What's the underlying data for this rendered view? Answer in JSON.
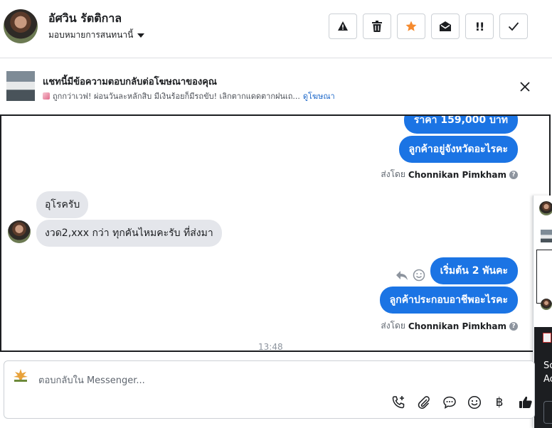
{
  "header": {
    "contact_name": "อัศวิน รัตติกาล",
    "assign_label": "มอบหมายการสนทนานี้"
  },
  "toolbar": {
    "icons": [
      "warning-icon",
      "trash-icon",
      "star-icon",
      "envelope-open-icon",
      "follow-up-icon",
      "check-icon"
    ],
    "follow_up_label": "!!",
    "star_color": "#f58a2e"
  },
  "ad_banner": {
    "title": "แชทนี้มีข้อความตอบกลับต่อโฆษณาของคุณ",
    "snippet": "ถูกกว่าเวฟ! ผ่อนวันละหลักสิบ มีเงินร้อยก็มีรถขับ! เลิกตากแดดตากฝนเถ...",
    "link": "ดูโฆษณา"
  },
  "messages": [
    {
      "dir": "out",
      "text": "ราคา 159,000 บาท"
    },
    {
      "dir": "out",
      "text": "ลูกค้าอยู่จังหวัดอะไรคะ"
    },
    {
      "type": "sent_by",
      "prefix": "ส่งโดย",
      "name": "Chonnikan Pimkham"
    },
    {
      "dir": "in",
      "text": "อุโรครับ"
    },
    {
      "dir": "in",
      "text": "งวด2,xxx กว่า ทุกคันไหมคะรับ ที่ส่งมา"
    },
    {
      "dir": "out",
      "text": "เริ่มต้น 2 พันคะ"
    },
    {
      "dir": "out",
      "text": "ลูกค้าประกอบอาชีพอะไรคะ"
    },
    {
      "type": "sent_by",
      "prefix": "ส่งโดย",
      "name": "Chonnikan Pimkham"
    }
  ],
  "timestamp": "13:48",
  "side_panel": {
    "text_1": "Sc",
    "text_2": "Ac"
  },
  "composer": {
    "placeholder": "ตอบกลับใน Messenger...",
    "icons": [
      "call-add-icon",
      "attachment-icon",
      "saved-reply-icon",
      "emoji-icon",
      "baht-icon",
      "thumbs-up-icon"
    ],
    "baht_glyph": "฿"
  },
  "colors": {
    "accent": "#1b74e4",
    "incoming_bubble": "#e4e6eb"
  }
}
